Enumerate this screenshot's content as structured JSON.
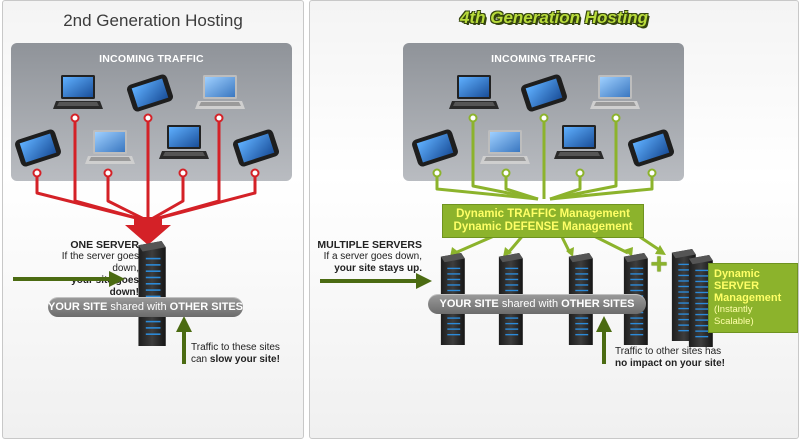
{
  "left": {
    "title": "2nd Generation Hosting",
    "incoming_traffic": "INCOMING TRAFFIC",
    "server_label": "ONE SERVER",
    "server_note_line1": "If the server goes down,",
    "server_note_line2": "your site goes down!",
    "bar_strong1": "YOUR SITE",
    "bar_mid": " shared with ",
    "bar_strong2": "OTHER SITES",
    "bottom_line1": "Traffic to these sites",
    "bottom_line2_pre": "can ",
    "bottom_line2_bold": "slow your site!"
  },
  "right": {
    "title": "4th Generation Hosting",
    "incoming_traffic": "INCOMING TRAFFIC",
    "mgmt_line1": "Dynamic TRAFFIC Management",
    "mgmt_line2": "Dynamic DEFENSE Management",
    "server_label": "MULTIPLE SERVERS",
    "server_note_line1": "If a server goes down,",
    "server_note_line2": "your site stays up.",
    "bar_strong1": "YOUR SITE",
    "bar_mid": " shared with ",
    "bar_strong2": "OTHER SITES",
    "dyn_line1": "Dynamic",
    "dyn_line2": "SERVER",
    "dyn_line3": "Management",
    "dyn_line4": "(Instantly Scalable)",
    "plus": "+",
    "bottom_line1": "Traffic to other sites has",
    "bottom_line2": "no impact on your site!"
  },
  "colors": {
    "left_lines": "#d42127",
    "right_lines": "#8cb32c",
    "arrow_dark_green": "#4b6b12",
    "mgmt_bg": "#8cb32c",
    "mgmt_text": "#ffff66"
  },
  "icons": [
    "laptop-icon",
    "tablet-icon",
    "server-rack-icon",
    "arrow-icon",
    "plus-icon"
  ]
}
